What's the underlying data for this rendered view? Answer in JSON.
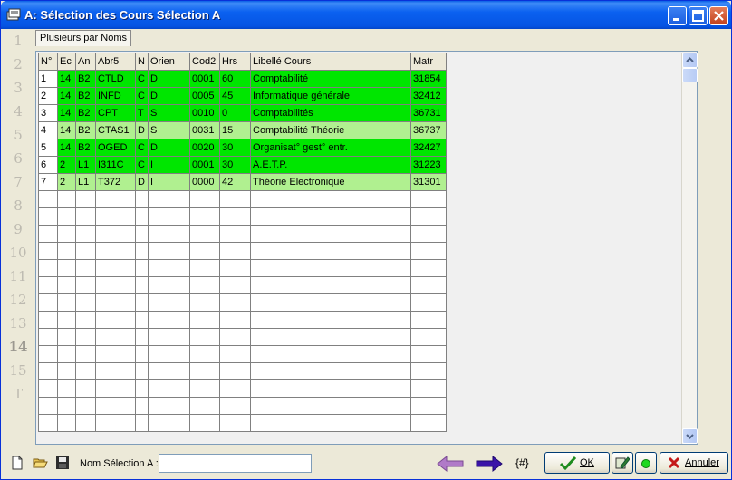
{
  "window": {
    "title": "A: Sélection des Cours Sélection A"
  },
  "tab": {
    "label": "Plusieurs par Noms"
  },
  "left_numbers": [
    "1",
    "2",
    "3",
    "4",
    "5",
    "6",
    "7",
    "8",
    "9",
    "10",
    "11",
    "12",
    "13",
    "14",
    "15",
    "T"
  ],
  "grid": {
    "columns": [
      "N°",
      "Ec",
      "An",
      "Abr5",
      "N",
      "Orien",
      "Cod2",
      "Hrs",
      "Libellé Cours",
      "Matr"
    ],
    "rows": [
      {
        "color": "#00e600",
        "cells": [
          "1",
          "14",
          "B2",
          "CTLD",
          "C",
          "D",
          "0001",
          "60",
          "Comptabilité",
          "31854"
        ]
      },
      {
        "color": "#00e600",
        "cells": [
          "2",
          "14",
          "B2",
          "INFD",
          "C",
          "D",
          "0005",
          "45",
          "Informatique générale",
          "32412"
        ]
      },
      {
        "color": "#00e600",
        "cells": [
          "3",
          "14",
          "B2",
          "CPT",
          "T",
          "S",
          "0010",
          "0",
          "Comptabilités",
          "36731"
        ]
      },
      {
        "color": "#b0f090",
        "cells": [
          "4",
          "14",
          "B2",
          "CTAS1",
          "D",
          "S",
          "0031",
          "15",
          "Comptabilité Théorie",
          "36737"
        ]
      },
      {
        "color": "#00e600",
        "cells": [
          "5",
          "14",
          "B2",
          "OGED",
          "C",
          "D",
          "0020",
          "30",
          "Organisat° gest° entr.",
          "32427"
        ]
      },
      {
        "color": "#00e600",
        "cells": [
          "6",
          "2",
          "L1",
          "I311C",
          "C",
          "I",
          "0001",
          "30",
          "A.E.T.P.",
          "31223"
        ]
      },
      {
        "color": "#b0f090",
        "cells": [
          "7",
          "2",
          "L1",
          "T372",
          "D",
          "I",
          "0000",
          "42",
          "Théorie Electronique",
          "31301"
        ]
      }
    ],
    "empty_rows": 14
  },
  "bottom": {
    "name_label": "Nom Sélection A :",
    "name_value": "",
    "hash_label": "{#}",
    "ok_label": "OK",
    "cancel_label": "Annuler"
  }
}
